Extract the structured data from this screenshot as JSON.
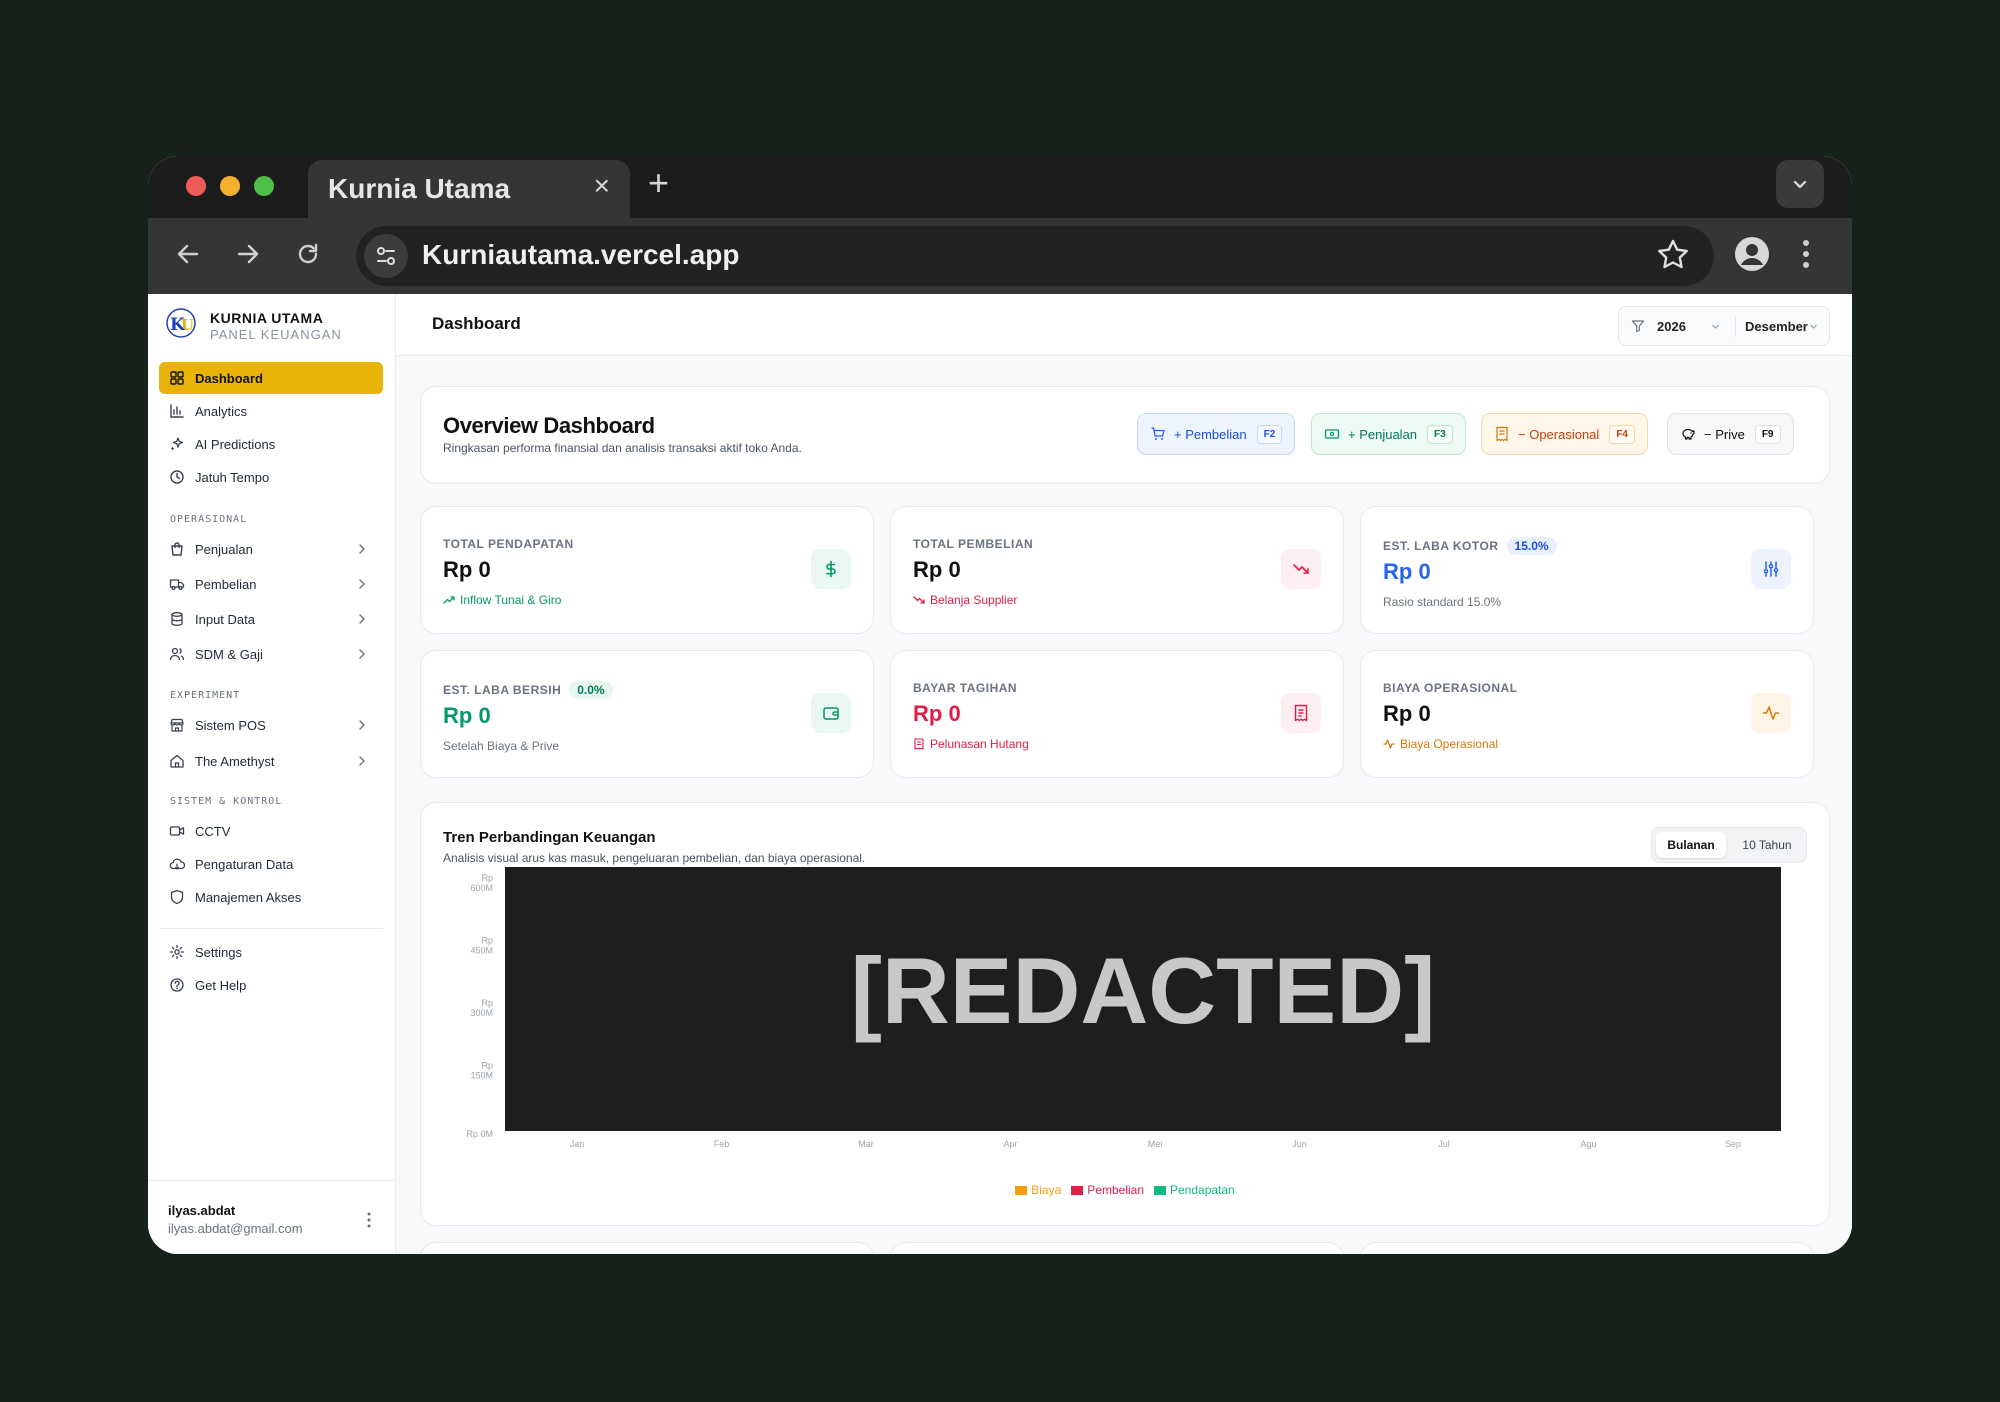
{
  "browser": {
    "tab_title": "Kurnia Utama",
    "tab_close": "×",
    "new_tab": "+",
    "url": "Kurniautama.vercel.app"
  },
  "brand": {
    "name": "KURNIA UTAMA",
    "subtitle": "PANEL KEUANGAN",
    "logo_text": "KU"
  },
  "sidebar": {
    "main": [
      {
        "label": "Dashboard",
        "icon": "grid-icon"
      },
      {
        "label": "Analytics",
        "icon": "bar-chart-icon"
      },
      {
        "label": "AI Predictions",
        "icon": "sparkles-icon"
      },
      {
        "label": "Jatuh Tempo",
        "icon": "clock-icon"
      }
    ],
    "section_ops": "OPERASIONAL",
    "ops": [
      {
        "label": "Penjualan",
        "icon": "shopping-bag-icon"
      },
      {
        "label": "Pembelian",
        "icon": "truck-icon"
      },
      {
        "label": "Input Data",
        "icon": "database-icon"
      },
      {
        "label": "SDM & Gaji",
        "icon": "users-icon"
      }
    ],
    "section_exp": "EXPERIMENT",
    "exp": [
      {
        "label": "Sistem POS",
        "icon": "store-icon"
      },
      {
        "label": "The Amethyst",
        "icon": "home-icon"
      }
    ],
    "section_sys": "SISTEM & KONTROL",
    "sys": [
      {
        "label": "CCTV",
        "icon": "video-icon"
      },
      {
        "label": "Pengaturan Data",
        "icon": "cloud-icon"
      },
      {
        "label": "Manajemen Akses",
        "icon": "shield-icon"
      }
    ],
    "bottom": [
      {
        "label": "Settings",
        "icon": "gear-icon"
      },
      {
        "label": "Get Help",
        "icon": "help-icon"
      }
    ],
    "user": {
      "name": "ilyas.abdat",
      "email": "ilyas.abdat@gmail.com"
    }
  },
  "header": {
    "title": "Dashboard",
    "year": "2026",
    "month": "Desember"
  },
  "overview": {
    "title": "Overview Dashboard",
    "subtitle": "Ringkasan performa finansial dan analisis transaksi aktif toko Anda.",
    "actions": [
      {
        "label": "+ Pembelian",
        "key": "F2"
      },
      {
        "label": "+ Penjualan",
        "key": "F3"
      },
      {
        "label": "− Operasional",
        "key": "F4"
      },
      {
        "label": "− Prive",
        "key": "F9"
      }
    ]
  },
  "stats": [
    {
      "label": "TOTAL PENDAPATAN",
      "value": "Rp 0",
      "foot": "Inflow Tunai & Giro",
      "badge": ""
    },
    {
      "label": "TOTAL PEMBELIAN",
      "value": "Rp 0",
      "foot": "Belanja Supplier",
      "badge": ""
    },
    {
      "label": "EST. LABA KOTOR",
      "value": "Rp 0",
      "foot": "Rasio standard 15.0%",
      "badge": "15.0%"
    },
    {
      "label": "EST. LABA BERSIH",
      "value": "Rp 0",
      "foot": "Setelah Biaya & Prive",
      "badge": "0.0%"
    },
    {
      "label": "BAYAR TAGIHAN",
      "value": "Rp 0",
      "foot": "Pelunasan Hutang",
      "badge": ""
    },
    {
      "label": "BIAYA OPERASIONAL",
      "value": "Rp 0",
      "foot": "Biaya Operasional",
      "badge": ""
    }
  ],
  "colors": {
    "accent": "#eab308",
    "income": "#059669",
    "expense": "#e11d48",
    "profit": "#2563eb",
    "operational": "#d97706"
  },
  "chart": {
    "redacted_text": "[REDACTED]",
    "toggle": {
      "active": "Bulanan",
      "inactive": "10 Tahun"
    }
  },
  "chart_data": {
    "type": "bar",
    "title": "Tren Perbandingan Keuangan",
    "subtitle": "Analisis visual arus kas masuk, pengeluaran pembelian, dan biaya operasional.",
    "categories": [
      "Jan",
      "Feb",
      "Mar",
      "Apr",
      "Mei",
      "Jun",
      "Jul",
      "Agu",
      "Sep"
    ],
    "y_ticks": [
      {
        "top": "Rp",
        "bottom": "600M"
      },
      {
        "top": "Rp",
        "bottom": "450M"
      },
      {
        "top": "Rp",
        "bottom": "300M"
      },
      {
        "top": "Rp",
        "bottom": "150M"
      },
      {
        "top": "",
        "bottom": "Rp 0M"
      }
    ],
    "ylim": [
      0,
      600
    ],
    "series": [
      {
        "name": "Biaya",
        "color": "#f59e0b"
      },
      {
        "name": "Pembelian",
        "color": "#e11d48"
      },
      {
        "name": "Pendapatan",
        "color": "#10b981"
      }
    ],
    "legend_position": "bottom"
  }
}
